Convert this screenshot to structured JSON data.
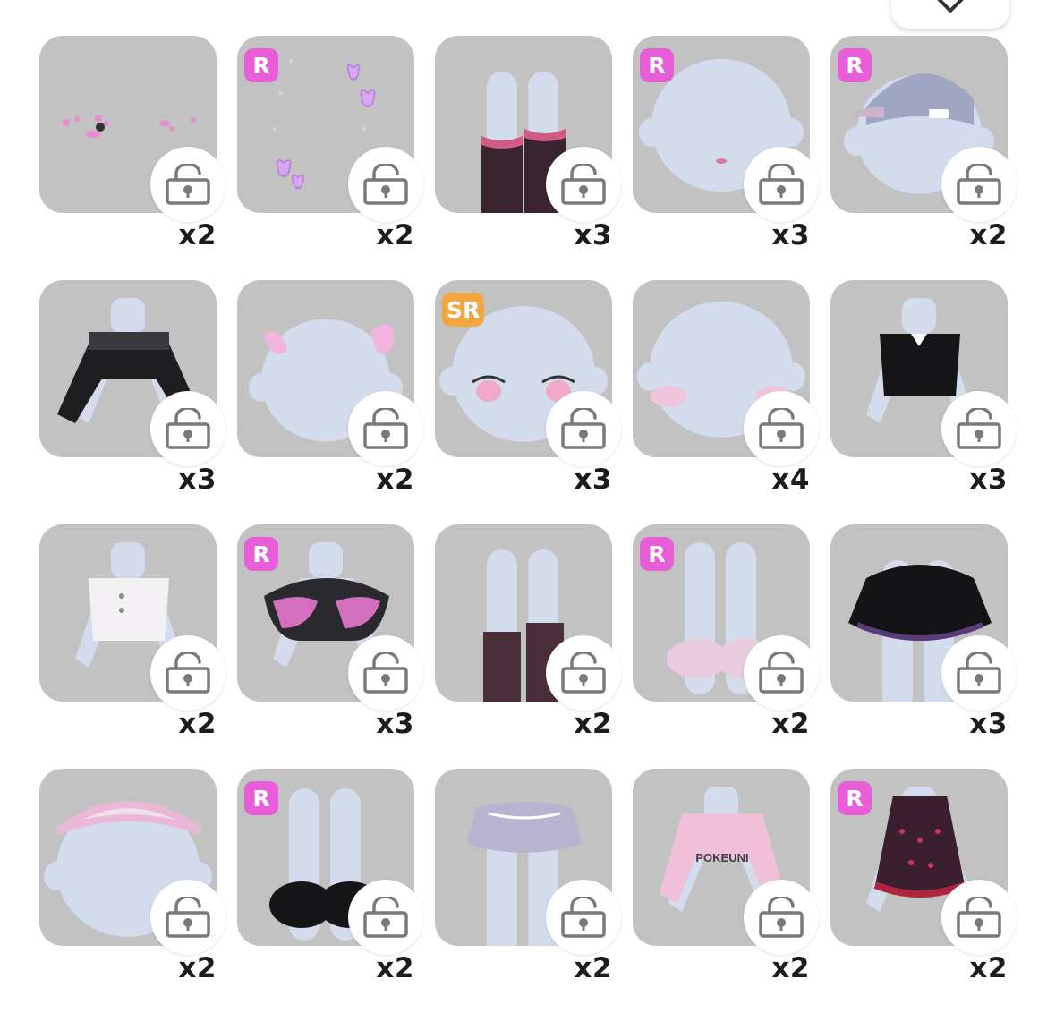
{
  "header": {
    "close_icon": "close-icon"
  },
  "colors": {
    "tile_bg": "#c2c2c2",
    "badge_R": "#e85dd8",
    "badge_SR": "#f2a640",
    "body_blue": "#d3dced",
    "lock_icon": "#7a7a7a"
  },
  "items": [
    {
      "kind": "sparkles",
      "badge": "",
      "count": "x2"
    },
    {
      "kind": "butterflies",
      "badge": "R",
      "count": "x2"
    },
    {
      "kind": "legwarmers",
      "badge": "",
      "count": "x3"
    },
    {
      "kind": "mouth",
      "badge": "R",
      "count": "x3"
    },
    {
      "kind": "cap",
      "badge": "R",
      "count": "x2"
    },
    {
      "kind": "black-top",
      "badge": "",
      "count": "x3"
    },
    {
      "kind": "butterfly-clips",
      "badge": "",
      "count": "x2"
    },
    {
      "kind": "eyes",
      "badge": "SR",
      "count": "x3"
    },
    {
      "kind": "blush",
      "badge": "",
      "count": "x4"
    },
    {
      "kind": "black-blouse",
      "badge": "",
      "count": "x3"
    },
    {
      "kind": "white-blouse",
      "badge": "",
      "count": "x2"
    },
    {
      "kind": "butterfly-cape",
      "badge": "R",
      "count": "x3"
    },
    {
      "kind": "socks",
      "badge": "",
      "count": "x2"
    },
    {
      "kind": "pink-shoes",
      "badge": "R",
      "count": "x2"
    },
    {
      "kind": "black-skirt",
      "badge": "",
      "count": "x3"
    },
    {
      "kind": "braid-headband",
      "badge": "",
      "count": "x2"
    },
    {
      "kind": "black-shoes",
      "badge": "R",
      "count": "x2"
    },
    {
      "kind": "lavender-skirt",
      "badge": "",
      "count": "x2"
    },
    {
      "kind": "pink-hoodie",
      "badge": "",
      "count": "x2",
      "print": "POKEUNI"
    },
    {
      "kind": "polka-dress",
      "badge": "R",
      "count": "x2"
    }
  ]
}
